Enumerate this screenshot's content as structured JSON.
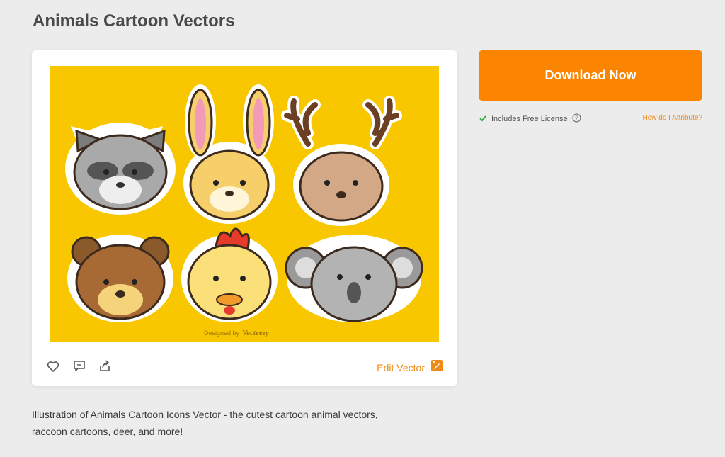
{
  "page": {
    "title": "Animals Cartoon Vectors"
  },
  "preview": {
    "watermark_prefix": "Designed by",
    "watermark_brand": "Vecteezy",
    "background_color": "#f8c700"
  },
  "toolbar": {
    "icons": [
      "heart-icon",
      "comment-icon",
      "share-icon"
    ],
    "edit_label": "Edit Vector"
  },
  "sidebar": {
    "download_label": "Download Now",
    "license_text": "Includes Free License",
    "attribute_link": "How do I Attribute?",
    "accent_color": "#fb8500"
  },
  "description": {
    "line1": "Illustration of Animals Cartoon Icons Vector - the cutest cartoon animal vectors,",
    "line2": "raccoon cartoons, deer, and more!"
  }
}
